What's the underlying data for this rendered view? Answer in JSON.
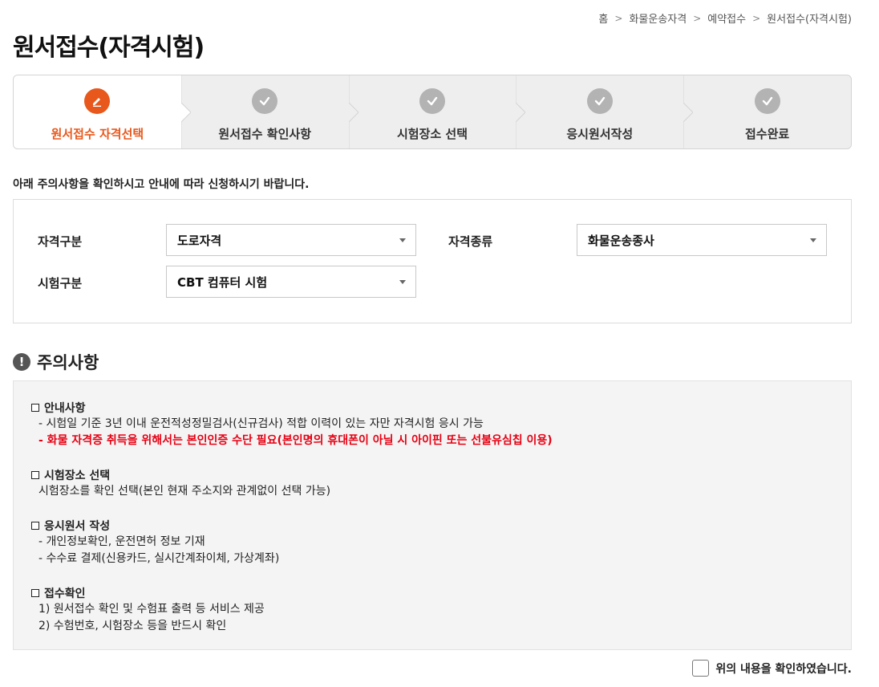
{
  "breadcrumb": [
    "홈",
    "화물운송자격",
    "예약접수",
    "원서접수(자격시험)"
  ],
  "page_title": "원서접수(자격시험)",
  "steps": [
    {
      "label": "원서접수 자격선택",
      "icon": "pencil-icon",
      "active": true
    },
    {
      "label": "원서접수 확인사항",
      "icon": "check-icon",
      "active": false
    },
    {
      "label": "시험장소 선택",
      "icon": "check-icon",
      "active": false
    },
    {
      "label": "응시원서작성",
      "icon": "check-icon",
      "active": false
    },
    {
      "label": "접수완료",
      "icon": "check-icon",
      "active": false
    }
  ],
  "intro_text": "아래 주의사항을 확인하시고 안내에 따라 신청하시기 바랍니다.",
  "form": {
    "qual_type_label": "자격구분",
    "qual_type_value": "도로자격",
    "qual_kind_label": "자격종류",
    "qual_kind_value": "화물운송종사",
    "exam_type_label": "시험구분",
    "exam_type_value": "CBT 컴퓨터 시험"
  },
  "notice": {
    "title": "주의사항",
    "sections": [
      {
        "title": "안내사항",
        "lines": [
          {
            "text": "- 시험일 기준 3년 이내 운전적성정밀검사(신규검사) 적합 이력이 있는 자만 자격시험 응시 가능",
            "red": false
          },
          {
            "text": "- 화물 자격증 취득을 위해서는 본인인증 수단 필요(본인명의 휴대폰이 아닐 시 아이핀 또는 선불유심칩 이용)",
            "red": true
          }
        ]
      },
      {
        "title": "시험장소 선택",
        "lines": [
          {
            "text": "시험장소를 확인 선택(본인 현재 주소지와 관계없이 선택 가능)",
            "red": false
          }
        ]
      },
      {
        "title": "응시원서 작성",
        "lines": [
          {
            "text": "- 개인정보확인, 운전면허 정보 기재",
            "red": false
          },
          {
            "text": "- 수수료 결제(신용카드, 실시간계좌이체, 가상계좌)",
            "red": false
          }
        ]
      },
      {
        "title": "접수확인",
        "lines": [
          {
            "text": "1) 원서접수 확인 및 수험표 출력 등 서비스 제공",
            "red": false
          },
          {
            "text": "2) 수험번호, 시험장소 등을 반드시 확인",
            "red": false
          }
        ]
      }
    ]
  },
  "confirm_label": "위의 내용을 확인하였습니다.",
  "colors": {
    "accent": "#e8581c",
    "warning": "#e60012",
    "inactive_step": "#b3b3b3"
  }
}
